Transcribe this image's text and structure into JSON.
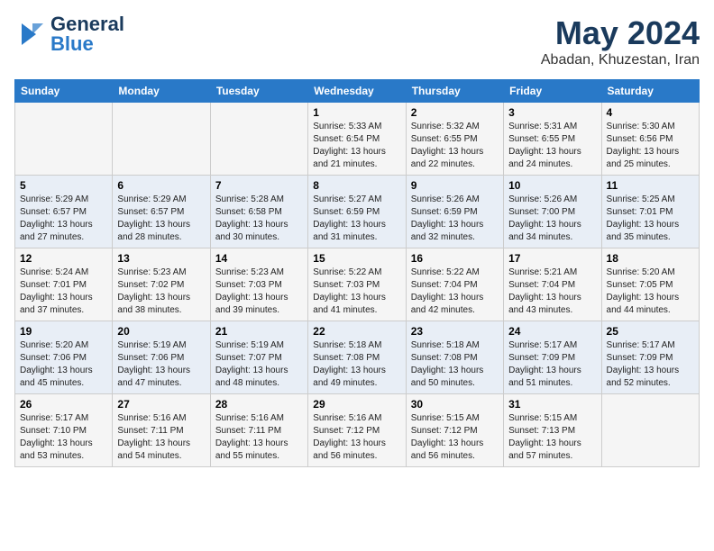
{
  "header": {
    "logo_line1": "General",
    "logo_line2": "Blue",
    "title": "May 2024",
    "location": "Abadan, Khuzestan, Iran"
  },
  "days_of_week": [
    "Sunday",
    "Monday",
    "Tuesday",
    "Wednesday",
    "Thursday",
    "Friday",
    "Saturday"
  ],
  "weeks": [
    [
      {
        "day": "",
        "info": ""
      },
      {
        "day": "",
        "info": ""
      },
      {
        "day": "",
        "info": ""
      },
      {
        "day": "1",
        "info": "Sunrise: 5:33 AM\nSunset: 6:54 PM\nDaylight: 13 hours\nand 21 minutes."
      },
      {
        "day": "2",
        "info": "Sunrise: 5:32 AM\nSunset: 6:55 PM\nDaylight: 13 hours\nand 22 minutes."
      },
      {
        "day": "3",
        "info": "Sunrise: 5:31 AM\nSunset: 6:55 PM\nDaylight: 13 hours\nand 24 minutes."
      },
      {
        "day": "4",
        "info": "Sunrise: 5:30 AM\nSunset: 6:56 PM\nDaylight: 13 hours\nand 25 minutes."
      }
    ],
    [
      {
        "day": "5",
        "info": "Sunrise: 5:29 AM\nSunset: 6:57 PM\nDaylight: 13 hours\nand 27 minutes."
      },
      {
        "day": "6",
        "info": "Sunrise: 5:29 AM\nSunset: 6:57 PM\nDaylight: 13 hours\nand 28 minutes."
      },
      {
        "day": "7",
        "info": "Sunrise: 5:28 AM\nSunset: 6:58 PM\nDaylight: 13 hours\nand 30 minutes."
      },
      {
        "day": "8",
        "info": "Sunrise: 5:27 AM\nSunset: 6:59 PM\nDaylight: 13 hours\nand 31 minutes."
      },
      {
        "day": "9",
        "info": "Sunrise: 5:26 AM\nSunset: 6:59 PM\nDaylight: 13 hours\nand 32 minutes."
      },
      {
        "day": "10",
        "info": "Sunrise: 5:26 AM\nSunset: 7:00 PM\nDaylight: 13 hours\nand 34 minutes."
      },
      {
        "day": "11",
        "info": "Sunrise: 5:25 AM\nSunset: 7:01 PM\nDaylight: 13 hours\nand 35 minutes."
      }
    ],
    [
      {
        "day": "12",
        "info": "Sunrise: 5:24 AM\nSunset: 7:01 PM\nDaylight: 13 hours\nand 37 minutes."
      },
      {
        "day": "13",
        "info": "Sunrise: 5:23 AM\nSunset: 7:02 PM\nDaylight: 13 hours\nand 38 minutes."
      },
      {
        "day": "14",
        "info": "Sunrise: 5:23 AM\nSunset: 7:03 PM\nDaylight: 13 hours\nand 39 minutes."
      },
      {
        "day": "15",
        "info": "Sunrise: 5:22 AM\nSunset: 7:03 PM\nDaylight: 13 hours\nand 41 minutes."
      },
      {
        "day": "16",
        "info": "Sunrise: 5:22 AM\nSunset: 7:04 PM\nDaylight: 13 hours\nand 42 minutes."
      },
      {
        "day": "17",
        "info": "Sunrise: 5:21 AM\nSunset: 7:04 PM\nDaylight: 13 hours\nand 43 minutes."
      },
      {
        "day": "18",
        "info": "Sunrise: 5:20 AM\nSunset: 7:05 PM\nDaylight: 13 hours\nand 44 minutes."
      }
    ],
    [
      {
        "day": "19",
        "info": "Sunrise: 5:20 AM\nSunset: 7:06 PM\nDaylight: 13 hours\nand 45 minutes."
      },
      {
        "day": "20",
        "info": "Sunrise: 5:19 AM\nSunset: 7:06 PM\nDaylight: 13 hours\nand 47 minutes."
      },
      {
        "day": "21",
        "info": "Sunrise: 5:19 AM\nSunset: 7:07 PM\nDaylight: 13 hours\nand 48 minutes."
      },
      {
        "day": "22",
        "info": "Sunrise: 5:18 AM\nSunset: 7:08 PM\nDaylight: 13 hours\nand 49 minutes."
      },
      {
        "day": "23",
        "info": "Sunrise: 5:18 AM\nSunset: 7:08 PM\nDaylight: 13 hours\nand 50 minutes."
      },
      {
        "day": "24",
        "info": "Sunrise: 5:17 AM\nSunset: 7:09 PM\nDaylight: 13 hours\nand 51 minutes."
      },
      {
        "day": "25",
        "info": "Sunrise: 5:17 AM\nSunset: 7:09 PM\nDaylight: 13 hours\nand 52 minutes."
      }
    ],
    [
      {
        "day": "26",
        "info": "Sunrise: 5:17 AM\nSunset: 7:10 PM\nDaylight: 13 hours\nand 53 minutes."
      },
      {
        "day": "27",
        "info": "Sunrise: 5:16 AM\nSunset: 7:11 PM\nDaylight: 13 hours\nand 54 minutes."
      },
      {
        "day": "28",
        "info": "Sunrise: 5:16 AM\nSunset: 7:11 PM\nDaylight: 13 hours\nand 55 minutes."
      },
      {
        "day": "29",
        "info": "Sunrise: 5:16 AM\nSunset: 7:12 PM\nDaylight: 13 hours\nand 56 minutes."
      },
      {
        "day": "30",
        "info": "Sunrise: 5:15 AM\nSunset: 7:12 PM\nDaylight: 13 hours\nand 56 minutes."
      },
      {
        "day": "31",
        "info": "Sunrise: 5:15 AM\nSunset: 7:13 PM\nDaylight: 13 hours\nand 57 minutes."
      },
      {
        "day": "",
        "info": ""
      }
    ]
  ]
}
